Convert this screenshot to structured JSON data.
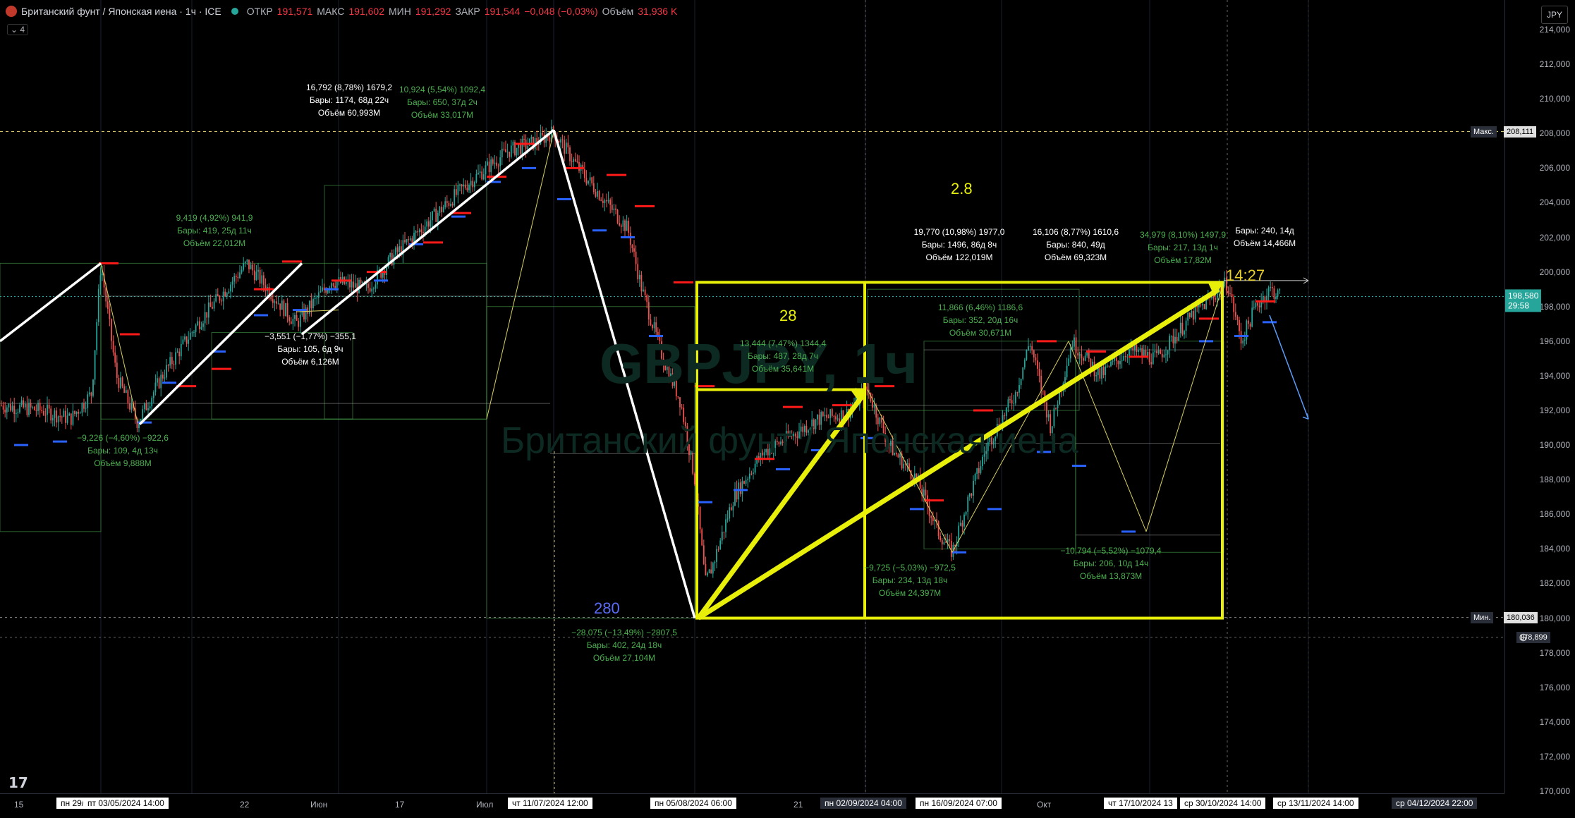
{
  "header": {
    "symbol_title": "Британский фунт / Японская иена · 1ч · ICE",
    "open_label": "ОТКР",
    "open_value": "191,571",
    "high_label": "МАКС",
    "high_value": "191,602",
    "low_label": "МИН",
    "low_value": "191,292",
    "close_label": "ЗАКР",
    "close_value": "191,544",
    "change_value": "−0,048 (−0,03%)",
    "volume_label": "Объём",
    "volume_value": "31,936 K",
    "indicators_count": "4",
    "currency": "JPY"
  },
  "watermark": {
    "ticker": "GBPJPY, 1ч",
    "name": "Британский фунт / Японская иена"
  },
  "logo_text": "17",
  "y_axis": {
    "ticks": [
      "214,000",
      "212,000",
      "210,000",
      "208,000",
      "206,000",
      "204,000",
      "202,000",
      "200,000",
      "198,000",
      "196,000",
      "194,000",
      "192,000",
      "190,000",
      "188,000",
      "186,000",
      "184,000",
      "182,000",
      "180,000",
      "178,000",
      "176,000",
      "174,000",
      "172,000",
      "170,000"
    ],
    "max_label": "Макс.",
    "max_value": "208,111",
    "min_label": "Мин.",
    "min_value": "180,036",
    "last_price": "198,580",
    "countdown": "29:58",
    "cross_price": "178,899"
  },
  "x_axis": {
    "labels": [
      "15",
      "22",
      "Июн",
      "17",
      "Июл",
      "21",
      "Окт"
    ],
    "boxes": [
      "пн 29/04",
      "пт 03/05/2024   14:00",
      "чт 11/07/2024   12:00",
      "пн 05/08/2024   06:00",
      "пн 02/09/2024   04:00",
      "пн 16/09/2024   07:00",
      "чт 17/10/2024   13",
      "ср 30/10/2024   14:00",
      "ср 13/11/2024   14:00",
      "ср 04/12/2024   22:00"
    ]
  },
  "annotations": {
    "a1": [
      "16,792 (8,78%) 1679,2",
      "Бары: 1174, 68д 22ч",
      "Объём 60,993M"
    ],
    "a2": [
      "10,924 (5,54%) 1092,4",
      "Бары: 650, 37д 2ч",
      "Объём 33,017M"
    ],
    "a3": [
      "9,419 (4,92%) 941,9",
      "Бары: 419, 25д 11ч",
      "Объём 22,012M"
    ],
    "a4": [
      "−3,551 (−1,77%) −355,1",
      "Бары: 105, 6д 9ч",
      "Объём 6,126M"
    ],
    "a5": [
      "−9,226 (−4,60%) −922,6",
      "Бары: 109, 4д 13ч",
      "Объём 9,888M"
    ],
    "a6": [
      "−28,075 (−13,49%) −2807,5",
      "Бары: 402, 24д 18ч",
      "Объём 27,104M"
    ],
    "a7": [
      "13,444 (7,47%) 1344,4",
      "Бары: 487, 28д 7ч",
      "Объём 35,641M"
    ],
    "a8": [
      "19,770 (10,98%) 1977,0",
      "Бары: 1496, 86д 8ч",
      "Объём 122,019M"
    ],
    "a9": [
      "16,106 (8,77%) 1610,6",
      "Бары: 840, 49д",
      "Объём 69,323M"
    ],
    "a10": [
      "34,979 (8,10%) 1497,9",
      "Бары: 217, 13д 1ч",
      "Объём 17,82M"
    ],
    "a11": [
      "Бары: 240, 14д",
      "Объём 14,466M"
    ],
    "a12": [
      "11,866 (6,46%) 1186,6",
      "Бары: 352, 20д 16ч",
      "Объём 30,671M"
    ],
    "a13": [
      "−9,725 (−5,03%) −972,5",
      "Бары: 234, 13д 18ч",
      "Объём 24,397M"
    ],
    "a14": [
      "−10,794 (−5,52%) −1079,4",
      "Бары: 206, 10д 14ч",
      "Объём 13,873M"
    ],
    "big_28": "28",
    "big_2_8": "2.8",
    "big_280": "280",
    "big_time": "14:27"
  },
  "colors": {
    "bull": "#26a69a",
    "bear": "#ef5350",
    "yellow": "#e8f00a",
    "white": "#ffffff",
    "blue_level": "#2962ff",
    "red_level": "#ff1a1a",
    "green_box": "#4caf50"
  }
}
